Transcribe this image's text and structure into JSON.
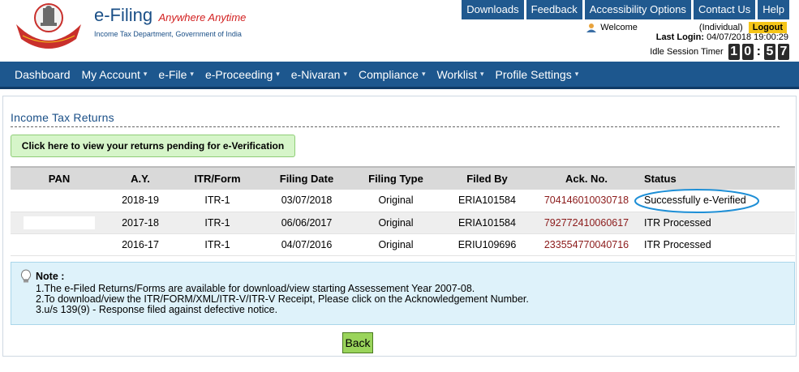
{
  "header": {
    "brand_title": "e-Filing",
    "brand_tagline": "Anywhere Anytime",
    "brand_sub": "Income Tax Department, Government of India",
    "emblem_text": "INCOME TAX DEPARTMENT",
    "top_links": [
      "Downloads",
      "Feedback",
      "Accessibility Options",
      "Contact Us",
      "Help"
    ],
    "welcome_label": "Welcome",
    "user_type": "(Individual)",
    "logout_label": "Logout",
    "last_login_label": "Last Login:",
    "last_login_value": "04/07/2018 19:00:29",
    "idle_label": "Idle Session Timer",
    "idle_digits": [
      "1",
      "0",
      "5",
      "7"
    ]
  },
  "nav": {
    "items": [
      {
        "label": "Dashboard",
        "caret": false
      },
      {
        "label": "My Account",
        "caret": true
      },
      {
        "label": "e-File",
        "caret": true
      },
      {
        "label": "e-Proceeding",
        "caret": true
      },
      {
        "label": "e-Nivaran",
        "caret": true
      },
      {
        "label": "Compliance",
        "caret": true
      },
      {
        "label": "Worklist",
        "caret": true
      },
      {
        "label": "Profile Settings",
        "caret": true
      }
    ]
  },
  "main": {
    "section_title": "Income Tax Returns",
    "pending_button": "Click here to view your returns pending for e-Verification",
    "table": {
      "headers": [
        "PAN",
        "A.Y.",
        "ITR/Form",
        "Filing Date",
        "Filing Type",
        "Filed By",
        "Ack. No.",
        "Status"
      ],
      "rows": [
        {
          "pan": "",
          "ay": "2018-19",
          "form": "ITR-1",
          "filing_date": "03/07/2018",
          "filing_type": "Original",
          "filed_by": "ERIA101584",
          "ack_no": "704146010030718",
          "status": "Successfully e-Verified"
        },
        {
          "pan": "",
          "ay": "2017-18",
          "form": "ITR-1",
          "filing_date": "06/06/2017",
          "filing_type": "Original",
          "filed_by": "ERIA101584",
          "ack_no": "792772410060617",
          "status": "ITR Processed"
        },
        {
          "pan": "",
          "ay": "2016-17",
          "form": "ITR-1",
          "filing_date": "04/07/2016",
          "filing_type": "Original",
          "filed_by": "ERIU109696",
          "ack_no": "233554770040716",
          "status": "ITR Processed"
        }
      ]
    },
    "note": {
      "title": "Note :",
      "lines": [
        "1.The e-Filed Returns/Forms are available for download/view starting Assessement Year 2007-08.",
        "2.To download/view the ITR/FORM/XML/ITR-V/ITR-V Receipt, Please click on the Acknowledgement Number.",
        "3.u/s 139(9) - Response filed against defective notice."
      ]
    },
    "back_label": "Back"
  },
  "colors": {
    "nav_bg": "#1d578e",
    "brand_blue": "#1a4f87",
    "ack_link": "#8b1a1a",
    "logout_bg": "#f5c518",
    "back_bg": "#9ad45b",
    "note_bg": "#def2fa",
    "highlight_ring": "#1e8fd6"
  }
}
